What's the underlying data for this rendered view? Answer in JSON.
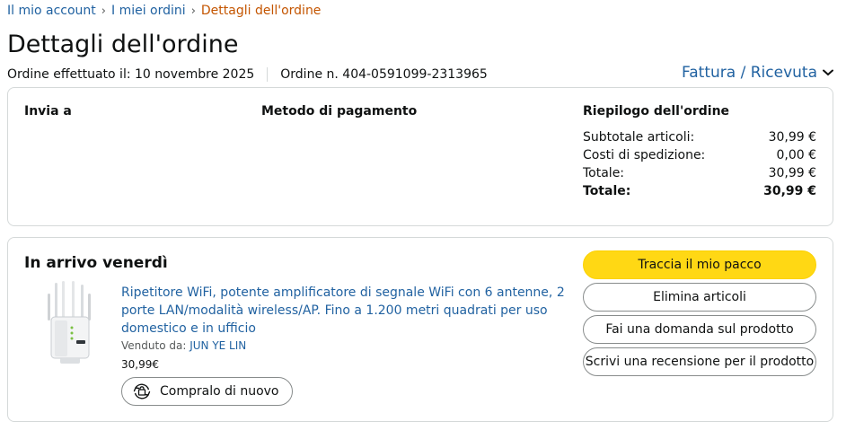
{
  "breadcrumb": {
    "account": "Il mio account",
    "orders": "I miei ordini",
    "current": "Dettagli dell'ordine",
    "separator": "›"
  },
  "page_title": "Dettagli dell'ordine",
  "order": {
    "placed": "Ordine effettuato il: 10 novembre 2025",
    "number": "Ordine n. 404-0591099-2313965"
  },
  "invoice_link": "Fattura / Ricevuta",
  "summary": {
    "ship_to": "Invia a",
    "payment_method": "Metodo di pagamento",
    "order_summary": "Riepilogo dell'ordine",
    "rows": [
      {
        "label": "Subtotale articoli:",
        "value": "30,99 €"
      },
      {
        "label": "Costi di spedizione:",
        "value": "0,00 €"
      },
      {
        "label": "Totale:",
        "value": "30,99 €"
      },
      {
        "label": "Totale:",
        "value": "30,99 €"
      }
    ]
  },
  "shipment": {
    "arrival": "In arrivo venerdì",
    "product_title": "Ripetitore WiFi, potente amplificatore di segnale WiFi con 6 antenne, 2 porte LAN/modalità wireless/AP. Fino a 1.200 metri quadrati per uso domestico e in ufficio",
    "sold_by_label": "Venduto da:",
    "seller": "JUN YE LIN",
    "price": "30,99€",
    "buy_again": "Compralo di nuovo"
  },
  "actions": {
    "track": "Traccia il mio pacco",
    "delete": "Elimina articoli",
    "ask": "Fai una domanda sul prodotto",
    "review": "Scrivi una recensione per il prodotto"
  },
  "colors": {
    "link": "#2162a1",
    "breadcrumb_current": "#c45500",
    "primary_button": "#ffd814",
    "border": "#d5d9d9"
  },
  "icons": {
    "chevron": "chevron-down-icon",
    "buy_again": "buy-again-icon",
    "product": "wifi-repeater-image"
  }
}
